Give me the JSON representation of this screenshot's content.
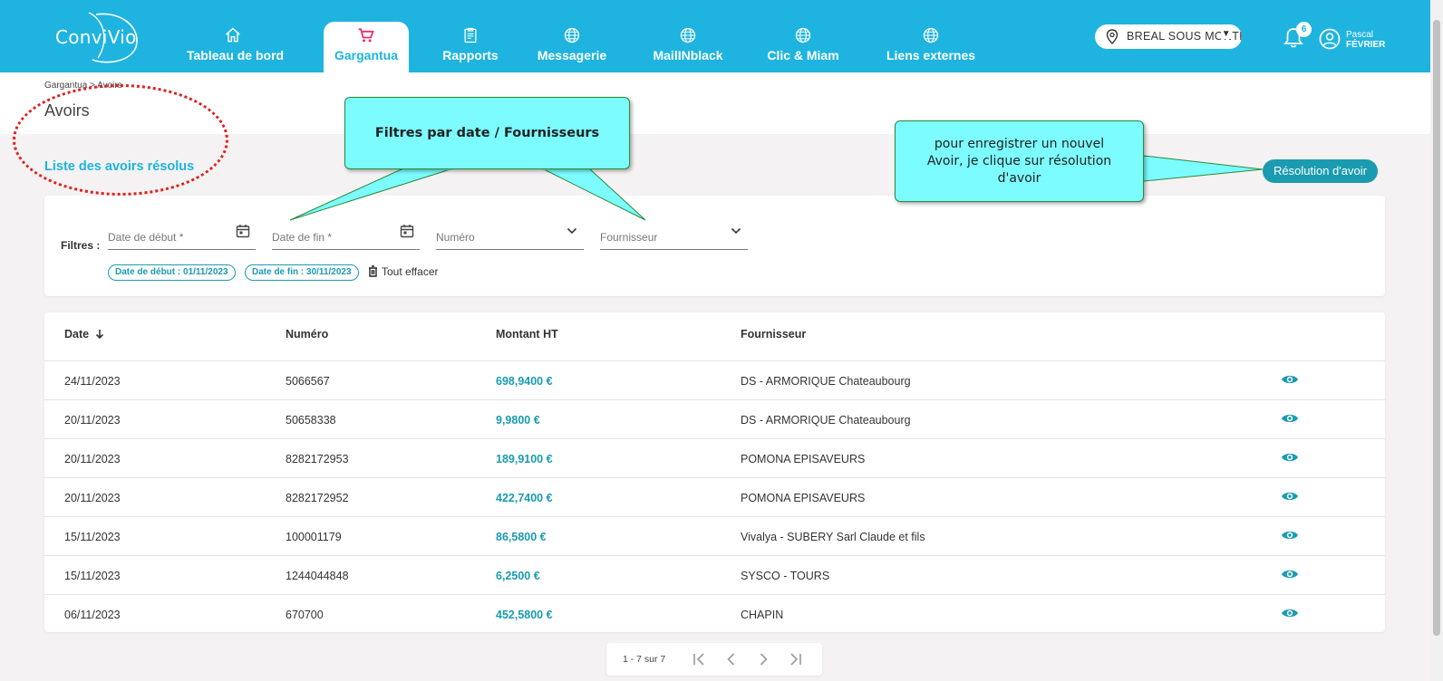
{
  "app": {
    "logo": "ConviVio"
  },
  "nav": {
    "items": [
      {
        "label": "Tableau de bord",
        "icon": "home-icon"
      },
      {
        "label": "Gargantua",
        "icon": "cart-icon"
      },
      {
        "label": "Rapports",
        "icon": "report-icon"
      },
      {
        "label": "Messagerie",
        "icon": "globe-icon"
      },
      {
        "label": "MailINblack",
        "icon": "globe-icon"
      },
      {
        "label": "Clic & Miam",
        "icon": "globe-icon"
      },
      {
        "label": "Liens externes",
        "icon": "globe-icon"
      }
    ],
    "active": "Gargantua"
  },
  "location": {
    "value": "BREAL SOUS MONTFORT"
  },
  "notifications": {
    "count": "6"
  },
  "user": {
    "first_name": "Pascal",
    "last_name": "FÉVRIER"
  },
  "breadcrumb": "Gargantua > Avoirs",
  "page_title": "Avoirs",
  "section_link": "Liste des avoirs résolus",
  "resolve_button": "Résolution d'avoir",
  "annotations": {
    "filters_note": "Filtres par date / Fournisseurs",
    "resolve_note_lines": [
      "pour enregistrer un nouvel",
      "Avoir, je clique sur résolution",
      "d'avoir"
    ]
  },
  "filters": {
    "label": "Filtres :",
    "start_date_placeholder": "Date de début *",
    "end_date_placeholder": "Date de fin *",
    "number_placeholder": "Numéro",
    "supplier_placeholder": "Fournisseur",
    "chips": [
      "Date de début : 01/11/2023",
      "Date de fin : 30/11/2023"
    ],
    "clear_all": "Tout effacer"
  },
  "table": {
    "columns": [
      "Date",
      "Numéro",
      "Montant HT",
      "Fournisseur"
    ],
    "rows": [
      {
        "date": "24/11/2023",
        "numero": "5066567",
        "montant": "698,9400 €",
        "fournisseur": "DS - ARMORIQUE Chateaubourg"
      },
      {
        "date": "20/11/2023",
        "numero": "50658338",
        "montant": "9,9800 €",
        "fournisseur": "DS - ARMORIQUE Chateaubourg"
      },
      {
        "date": "20/11/2023",
        "numero": "8282172953",
        "montant": "189,9100 €",
        "fournisseur": "POMONA EPISAVEURS"
      },
      {
        "date": "20/11/2023",
        "numero": "8282172952",
        "montant": "422,7400 €",
        "fournisseur": "POMONA EPISAVEURS"
      },
      {
        "date": "15/11/2023",
        "numero": "100001179",
        "montant": "86,5800 €",
        "fournisseur": "Vivalya - SUBERY Sarl Claude et fils"
      },
      {
        "date": "15/11/2023",
        "numero": "1244044848",
        "montant": "6,2500 €",
        "fournisseur": "SYSCO - TOURS"
      },
      {
        "date": "06/11/2023",
        "numero": "670700",
        "montant": "452,5800 €",
        "fournisseur": "CHAPIN"
      }
    ]
  },
  "pagination": {
    "text": "1 - 7 sur 7"
  },
  "colors": {
    "brand": "#1eb4df",
    "accent": "#1a9bb0",
    "annotation_fill": "#7cfcff",
    "annotation_ring": "#e02020"
  }
}
